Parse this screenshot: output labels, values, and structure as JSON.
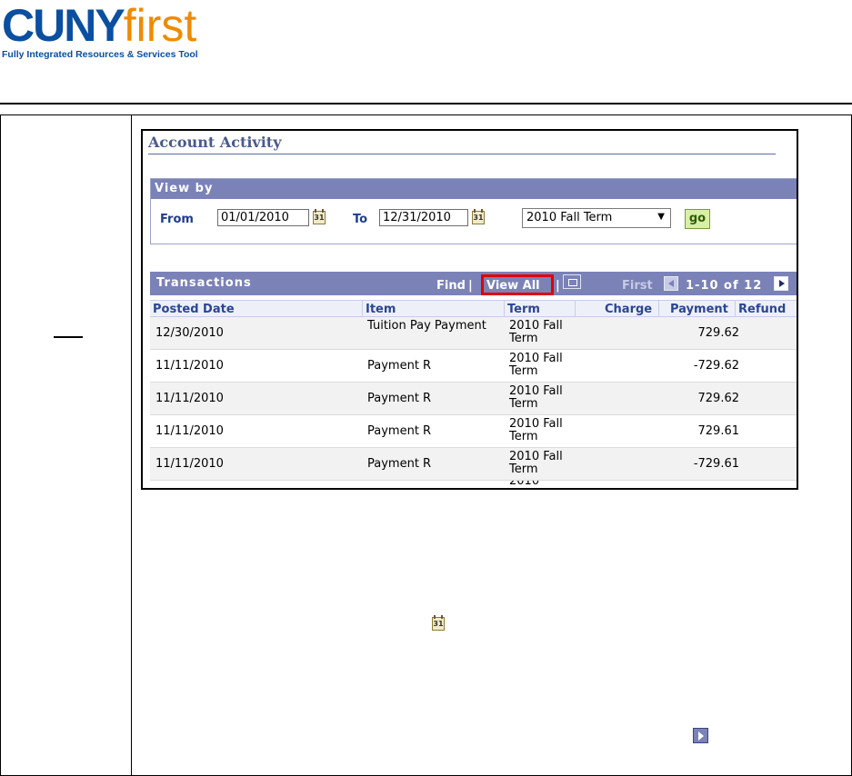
{
  "logo": {
    "cuny": "CUNY",
    "first": "first",
    "tagline": "Fully Integrated Resources & Services Tool"
  },
  "account_activity": {
    "title": "Account Activity",
    "view_by": {
      "header": "View by",
      "from_label": "From",
      "from_value": "01/01/2010",
      "to_label": "To",
      "to_value": "12/31/2010",
      "term_selected": "2010 Fall Term",
      "go_label": "go",
      "calendar_glyph": "31"
    },
    "transactions": {
      "title": "Transactions",
      "find": "Find",
      "view_all": "View All",
      "sep": "|",
      "first": "First",
      "range": "1-10 of 12",
      "columns": [
        "Posted Date",
        "Item",
        "Term",
        "Charge",
        "Payment",
        "Refund"
      ],
      "rows": [
        {
          "date": "12/30/2010",
          "item": "Tuition Pay Payment",
          "term": "2010 Fall Term",
          "charge": "",
          "payment": "729.62",
          "refund": ""
        },
        {
          "date": "11/11/2010",
          "item": "Payment R",
          "term": "2010 Fall Term",
          "charge": "",
          "payment": "-729.62",
          "refund": ""
        },
        {
          "date": "11/11/2010",
          "item": "Payment R",
          "term": "2010 Fall Term",
          "charge": "",
          "payment": "729.62",
          "refund": ""
        },
        {
          "date": "11/11/2010",
          "item": "Payment R",
          "term": "2010 Fall Term",
          "charge": "",
          "payment": "729.61",
          "refund": ""
        },
        {
          "date": "11/11/2010",
          "item": "Payment R",
          "term": "2010 Fall Term",
          "charge": "",
          "payment": "-729.61",
          "refund": ""
        }
      ],
      "partial_row_term": "2010"
    }
  },
  "icons": {
    "calendar": "calendar-icon",
    "next": "next-arrow-icon",
    "prev": "prev-arrow-icon",
    "popout": "popout-icon"
  },
  "colors": {
    "header_bar": "#7a82b8",
    "view_all_highlight": "#e00000",
    "cuny_blue": "#0b4fa0",
    "first_orange": "#f08a00"
  }
}
